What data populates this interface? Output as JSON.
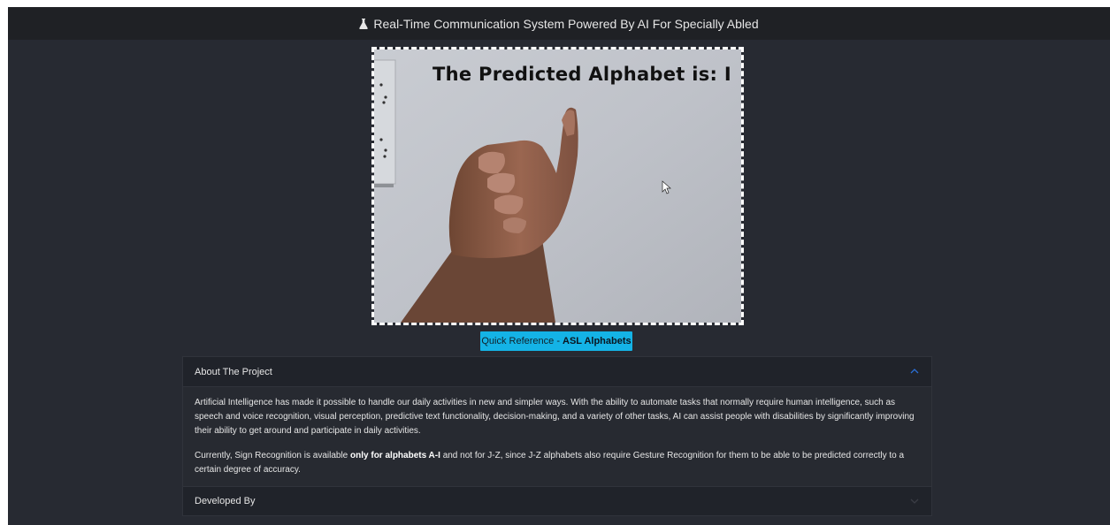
{
  "navbar": {
    "title": "Real-Time Communication System Powered By AI For Specially Abled",
    "icon": "flask-icon"
  },
  "video": {
    "prediction_text": "The Predicted Alphabet is: I"
  },
  "quick_reference": {
    "prefix": "Quick Reference -",
    "bold": "ASL Alphabets",
    "color": "#14b3e6"
  },
  "accordion": {
    "about": {
      "title": "About The Project",
      "paragraph1": "Artificial Intelligence has made it possible to handle our daily activities in new and simpler ways. With the ability to automate tasks that normally require human intelligence, such as speech and voice recognition, visual perception, predictive text functionality, decision-making, and a variety of other tasks, AI can assist people with disabilities by significantly improving their ability to get around and participate in daily activities.",
      "p2_before": "Currently, Sign Recognition is available",
      "p2_bold": "only for alphabets A-I",
      "p2_after": "and not for J-Z, since J-Z alphabets also require Gesture Recognition for them to be able to be predicted correctly to a certain degree of accuracy."
    },
    "developed": {
      "title": "Developed By"
    }
  }
}
